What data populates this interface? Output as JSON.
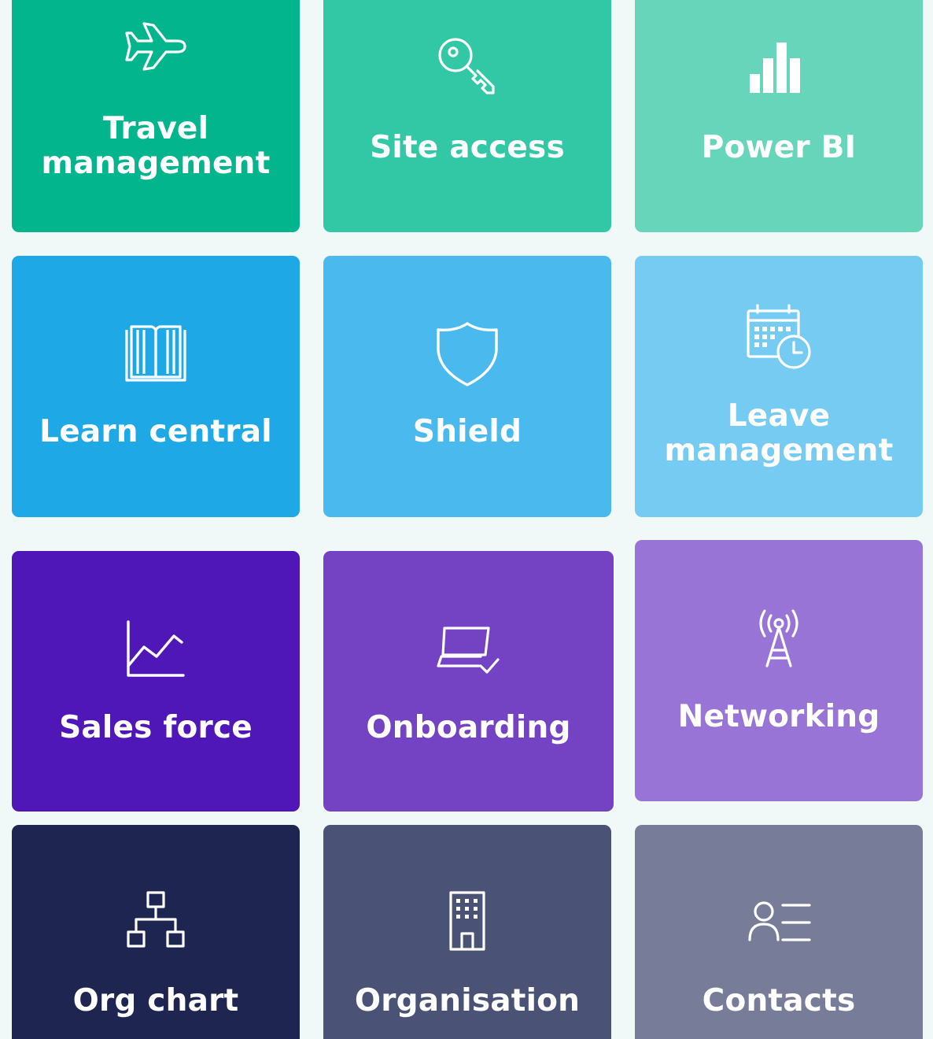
{
  "tiles": {
    "travel": {
      "label": "Travel\nmanagement",
      "icon": "airplane-icon",
      "color": "#03b58c"
    },
    "site_access": {
      "label": "Site access",
      "icon": "key-icon",
      "color": "#33c8a5"
    },
    "power_bi": {
      "label": "Power BI",
      "icon": "bar-chart-icon",
      "color": "#66d5ba"
    },
    "learn": {
      "label": "Learn central",
      "icon": "book-icon",
      "color": "#1fa8e6"
    },
    "shield": {
      "label": "Shield",
      "icon": "shield-icon",
      "color": "#4abaee"
    },
    "leave": {
      "label": "Leave\nmanagement",
      "icon": "calendar-clock-icon",
      "color": "#76cbf2"
    },
    "sales": {
      "label": "Sales force",
      "icon": "line-chart-icon",
      "color": "#4f16b8"
    },
    "onboarding": {
      "label": "Onboarding",
      "icon": "laptop-check-icon",
      "color": "#7443c4"
    },
    "networking": {
      "label": "Networking",
      "icon": "antenna-icon",
      "color": "#9774d5"
    },
    "org_chart": {
      "label": "Org chart",
      "icon": "org-chart-icon",
      "color": "#1d2550"
    },
    "organisation": {
      "label": "Organisation",
      "icon": "building-icon",
      "color": "#4a5275"
    },
    "contacts": {
      "label": "Contacts",
      "icon": "contact-list-icon",
      "color": "#777c98"
    }
  }
}
